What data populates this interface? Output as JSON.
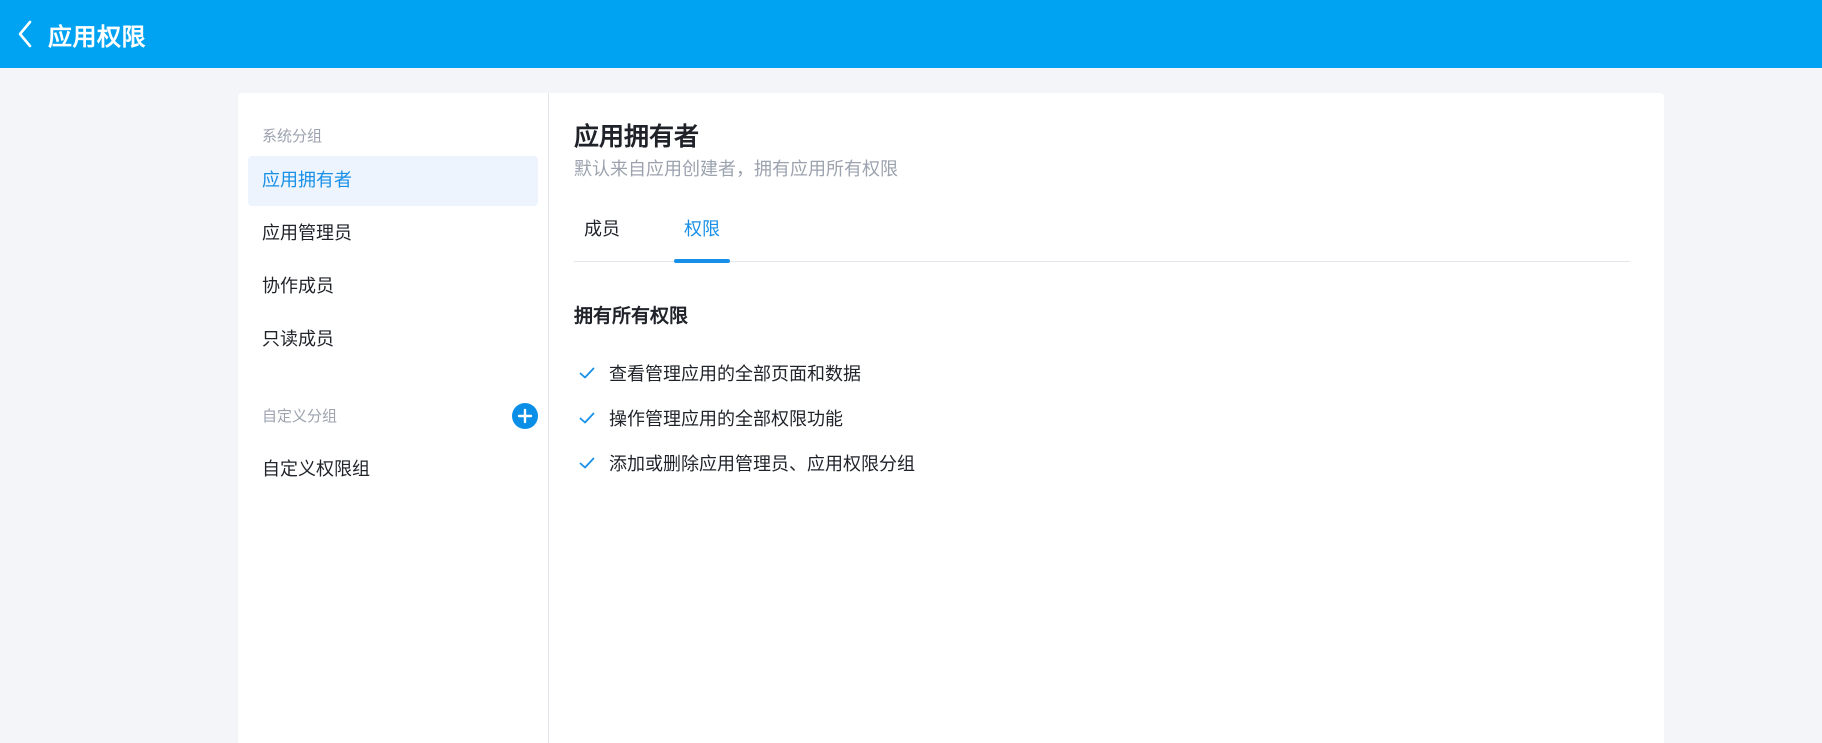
{
  "header": {
    "title": "应用权限",
    "back_icon": "chevron-left-icon"
  },
  "sidebar": {
    "system_group_label": "系统分组",
    "system_items": [
      {
        "label": "应用拥有者",
        "active": true
      },
      {
        "label": "应用管理员",
        "active": false
      },
      {
        "label": "协作成员",
        "active": false
      },
      {
        "label": "只读成员",
        "active": false
      }
    ],
    "custom_group_label": "自定义分组",
    "add_icon": "plus-circle-icon",
    "custom_items": [
      {
        "label": "自定义权限组"
      }
    ]
  },
  "main": {
    "title": "应用拥有者",
    "description": "默认来自应用创建者，拥有应用所有权限",
    "tabs": [
      {
        "label": "成员",
        "active": false
      },
      {
        "label": "权限",
        "active": true
      }
    ],
    "permissions_heading": "拥有所有权限",
    "permissions": [
      "查看管理应用的全部页面和数据",
      "操作管理应用的全部权限功能",
      "添加或删除应用管理员、应用权限分组"
    ]
  },
  "colors": {
    "header_bg": "#00a2f2",
    "accent": "#1890e8",
    "active_item_bg": "#edf4fd"
  }
}
